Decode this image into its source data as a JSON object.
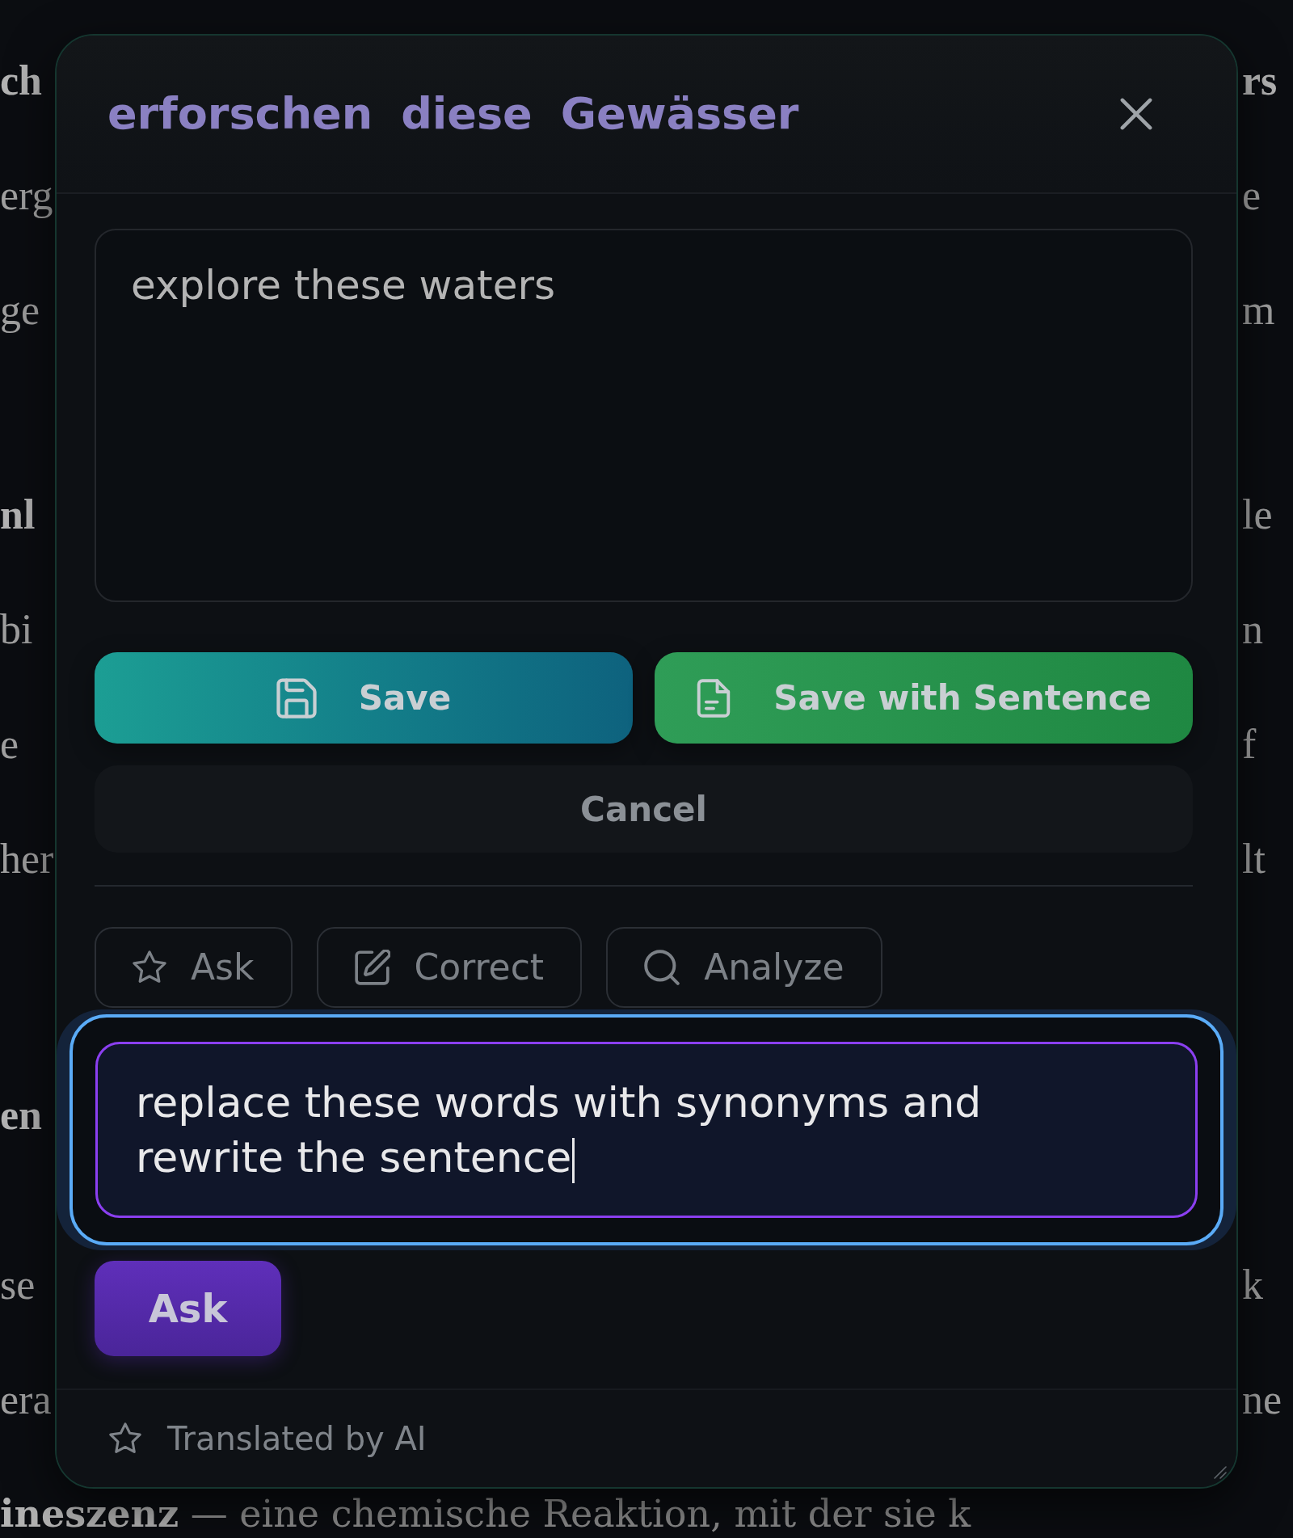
{
  "background_text": {
    "paragraphs": [
      {
        "lines": [
          {
            "left": {
              "text": "ch",
              "bold": true
            },
            "right": {
              "text": "rs",
              "bold": true
            }
          },
          {
            "left": {
              "text": "erg",
              "bold": false
            },
            "right": {
              "text": "e",
              "bold": false
            }
          },
          {
            "left": {
              "text": "ge",
              "bold": false
            },
            "right": {
              "text": "m",
              "bold": false
            }
          }
        ]
      },
      {
        "lines": [
          {
            "left": {
              "text": "nl",
              "bold": true
            },
            "right": {
              "text": "le",
              "bold": false
            }
          },
          {
            "left": {
              "text": "bi",
              "bold": false
            },
            "right": {
              "text": "n",
              "bold": false
            }
          },
          {
            "left": {
              "text": "e",
              "bold": false
            },
            "right": {
              "text": "f",
              "bold": false
            }
          },
          {
            "left": {
              "text": "her",
              "bold": false
            },
            "right": {
              "text": "lt",
              "bold": false
            }
          }
        ]
      },
      {
        "lines": [
          {
            "left": {
              "text": "en",
              "bold": true
            }
          }
        ]
      },
      {
        "lines": [
          {
            "left": {
              "text": "se",
              "bold": false
            },
            "right": {
              "text": "k",
              "bold": false
            }
          },
          {
            "left": {
              "text": "era",
              "bold": false
            },
            "right": {
              "text": "ne",
              "bold": false
            }
          }
        ]
      }
    ],
    "bottom_line": "**ineszenz** — eine chemische Reaktion, mit der sie k"
  },
  "dialog": {
    "title": "erforschen diese Gewässer",
    "translation": {
      "value": "explore these waters"
    },
    "actions": [
      {
        "kind": "save",
        "label": "Save"
      },
      {
        "kind": "save_sentence",
        "label": "Save with Sentence"
      }
    ],
    "cancel": {
      "label": "Cancel"
    },
    "tabs": [
      {
        "kind": "ask",
        "label": "Ask"
      },
      {
        "kind": "correct",
        "label": "Correct"
      },
      {
        "kind": "analyze",
        "label": "Analyze"
      }
    ],
    "question": {
      "value": "replace these words with synonyms and rewrite the sentence",
      "focused": true
    },
    "submit": {
      "label": "Ask"
    },
    "footer": {
      "label": "Translated by AI"
    }
  }
}
